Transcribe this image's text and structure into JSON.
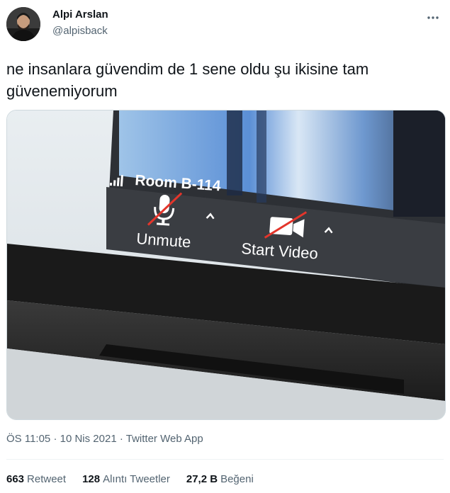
{
  "user": {
    "display_name": "Alpi Arslan",
    "handle": "@alpisback"
  },
  "tweet": {
    "text": "ne insanlara güvendim de 1 sene oldu şu ikisine tam güvenemiyorum"
  },
  "photo": {
    "room_label": "Room B-114",
    "unmute_label": "Unmute",
    "start_video_label": "Start Video"
  },
  "meta": {
    "time": "ÖS 11:05",
    "sep1": "·",
    "date": "10 Nis 2021",
    "sep2": "·",
    "source": "Twitter Web App"
  },
  "stats": {
    "retweets_count": "663",
    "retweets_label": "Retweet",
    "quotes_count": "128",
    "quotes_label": "Alıntı Tweetler",
    "likes_count": "27,2 B",
    "likes_label": "Beğeni"
  },
  "colors": {
    "text_primary": "#0f1419",
    "text_secondary": "#536471",
    "zoom_bar": "#3a3d42",
    "mute_slash": "#e3352b"
  },
  "icons": {
    "more": "more-icon",
    "signal": "signal-icon",
    "mic": "microphone-muted-icon",
    "camera": "camera-off-icon",
    "caret": "caret-up-icon"
  }
}
